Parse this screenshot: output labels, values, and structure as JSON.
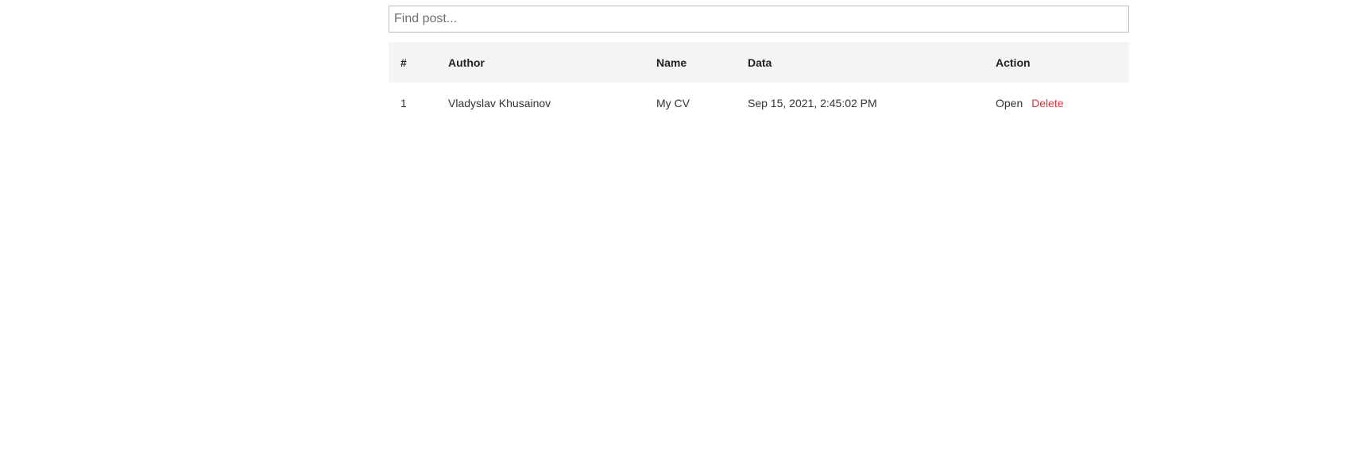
{
  "search": {
    "placeholder": "Find post...",
    "value": ""
  },
  "table": {
    "headers": {
      "num": "#",
      "author": "Author",
      "name": "Name",
      "data": "Data",
      "action": "Action"
    },
    "rows": [
      {
        "num": "1",
        "author": "Vladyslav Khusainov",
        "name": "My CV",
        "data": "Sep 15, 2021, 2:45:02 PM",
        "open_label": "Open",
        "delete_label": "Delete"
      }
    ]
  },
  "colors": {
    "header_bg": "#f4f4f4",
    "delete": "#d9363e",
    "text": "#333333",
    "input_border": "#bdbdbd"
  }
}
